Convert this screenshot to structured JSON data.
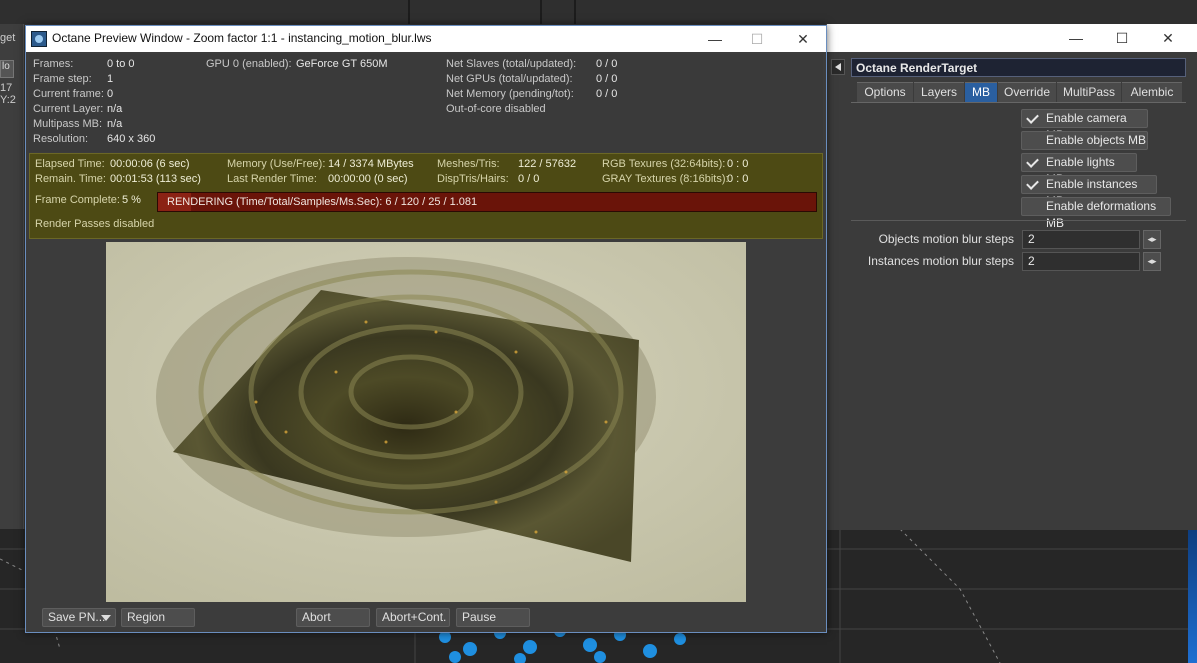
{
  "background_app": {
    "left_labels": [
      "get",
      "lo",
      "17 Y:2"
    ]
  },
  "render_target": {
    "title": "Octane RenderTarget",
    "window_controls": {
      "minimize": "—",
      "maximize": "☐",
      "close": "✕"
    },
    "tabs": [
      {
        "label": "Options",
        "active": false
      },
      {
        "label": "Layers",
        "active": false
      },
      {
        "label": "MB",
        "active": true
      },
      {
        "label": "Override",
        "active": false
      },
      {
        "label": "MultiPass",
        "active": false
      },
      {
        "label": "Alembic",
        "active": false
      }
    ],
    "checkboxes": [
      {
        "label": "Enable camera MB",
        "checked": true
      },
      {
        "label": "Enable objects MB",
        "checked": false
      },
      {
        "label": "Enable lights MB",
        "checked": true
      },
      {
        "label": "Enable instances MB",
        "checked": true
      },
      {
        "label": "Enable deformations MB",
        "checked": false
      }
    ],
    "fields": [
      {
        "label": "Objects motion blur steps",
        "value": "2"
      },
      {
        "label": "Instances motion blur steps",
        "value": "2"
      }
    ],
    "spin_glyph": "◂▸"
  },
  "preview": {
    "title": "Octane Preview Window - Zoom factor 1:1 - instancing_motion_blur.lws",
    "window_controls": {
      "minimize": "—",
      "maximize": "☐",
      "close": "✕"
    },
    "info": {
      "frames_label": "Frames:",
      "frames_value": "0 to 0",
      "frame_step_label": "Frame step:",
      "frame_step_value": "1",
      "current_frame_label": "Current frame:",
      "current_frame_value": "0",
      "current_layer_label": "Current Layer:",
      "current_layer_value": "n/a",
      "multipass_label": "Multipass MB:",
      "multipass_value": "n/a",
      "resolution_label": "Resolution:",
      "resolution_value": "640 x 360",
      "gpu_label": "GPU  0 (enabled):",
      "gpu_value": "GeForce GT 650M",
      "net_slaves_label": "Net Slaves (total/updated):",
      "net_slaves_value": "0 / 0",
      "net_gpus_label": "Net GPUs (total/updated):",
      "net_gpus_value": "0 / 0",
      "net_memory_label": "Net Memory (pending/tot):",
      "net_memory_value": "0 / 0",
      "out_of_core": "Out-of-core disabled"
    },
    "stats": {
      "elapsed_label": "Elapsed Time:",
      "elapsed_value": "00:00:06 (6 sec)",
      "remain_label": "Remain. Time:",
      "remain_value": "00:01:53 (113 sec)",
      "memory_label": "Memory (Use/Free):",
      "memory_value": "14 / 3374 MBytes",
      "last_render_label": "Last Render Time:",
      "last_render_value": "00:00:00 (0 sec)",
      "meshes_label": "Meshes/Tris:",
      "meshes_value": "122 / 57632",
      "disptris_label": "DispTris/Hairs:",
      "disptris_value": "0 / 0",
      "rgb_label": "RGB Texures (32:64bits):",
      "rgb_value": "0 : 0",
      "gray_label": "GRAY Textures (8:16bits):",
      "gray_value": "0 : 0",
      "frame_complete_label": "Frame Complete:",
      "frame_complete_value": "5 %",
      "progress_fraction": 0.05,
      "progress_text": "RENDERING (Time/Total/Samples/Ms.Sec): 6 / 120 / 25 / 1.081",
      "render_passes": "Render Passes disabled"
    },
    "buttons": {
      "save": "Save PN...",
      "region": "Region",
      "abort": "Abort",
      "abort_cont": "Abort+Cont.",
      "pause": "Pause"
    }
  }
}
